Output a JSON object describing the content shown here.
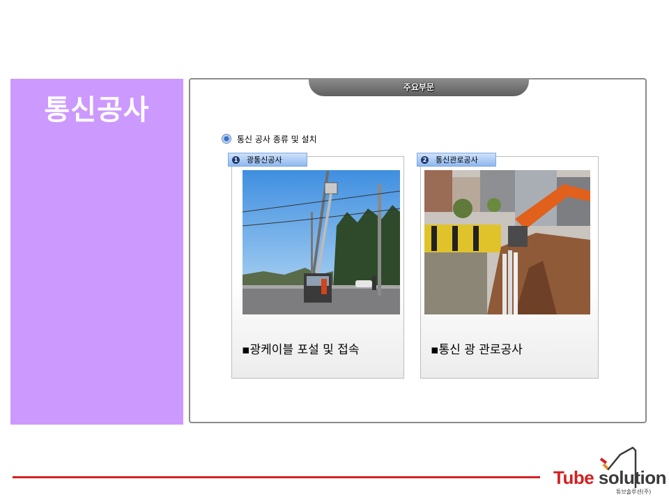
{
  "side": {
    "title": "통신공사"
  },
  "main": {
    "section_tab": "주요부문",
    "bullet": "통신 공사 종류 및 설치",
    "cards": [
      {
        "number": "1",
        "badge": "광통신공사",
        "caption": "▪광케이블 포설 및 접속",
        "photo": "utility-pole-crane-photo"
      },
      {
        "number": "2",
        "badge": "통신관로공사",
        "caption": "▪통신 광 관로공사",
        "photo": "excavator-trench-photo"
      }
    ]
  },
  "footer": {
    "logo_word1": "Tube",
    "logo_word2": "solution",
    "logo_sub": "튜브솔루션(주)",
    "accent_color": "#d42020"
  }
}
